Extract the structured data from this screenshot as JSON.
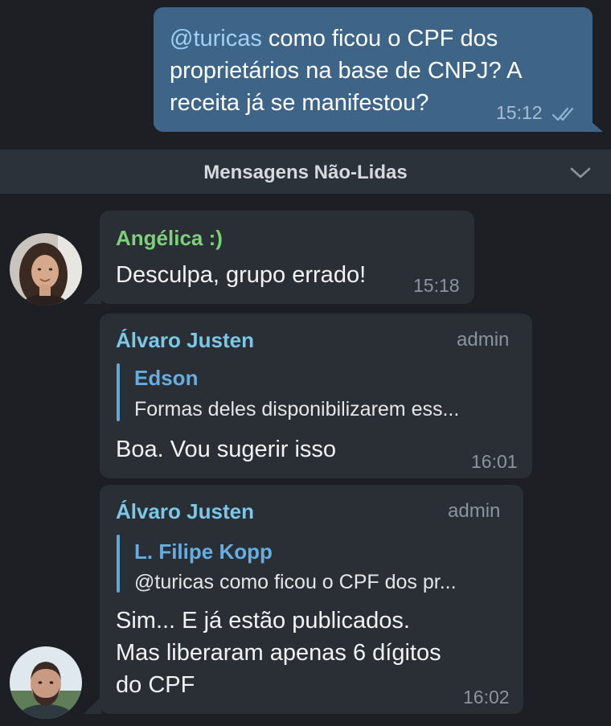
{
  "outgoing": {
    "mention": "@turicas",
    "text": " como ficou o CPF dos proprietários na base de CNPJ? A receita já se manifestou?",
    "time": "15:12"
  },
  "unread_divider": {
    "label": "Mensagens Não-Lidas"
  },
  "messages": [
    {
      "sender": "Angélica :)",
      "sender_color": "#7ed07a",
      "text": "Desculpa, grupo errado!",
      "time": "15:18"
    },
    {
      "sender": "Álvaro Justen",
      "sender_color": "#7cc6e6",
      "badge": "admin",
      "reply_name": "Edson",
      "reply_text": "Formas deles disponibilizarem ess...",
      "text": "Boa. Vou sugerir isso",
      "time": "16:01"
    },
    {
      "sender": "Álvaro Justen",
      "sender_color": "#7cc6e6",
      "badge": "admin",
      "reply_name": "L. Filipe Kopp",
      "reply_text": "@turicas como ficou o CPF dos pr...",
      "text_lines": [
        "Sim... E já estão publicados.",
        "Mas liberaram apenas 6 dígitos",
        "do CPF"
      ],
      "time": "16:02"
    }
  ],
  "colors": {
    "background": "#1d1f24",
    "outgoing_bubble": "#3e6587",
    "incoming_bubble": "#2a2e35",
    "reply_accent": "#63a5d6"
  }
}
